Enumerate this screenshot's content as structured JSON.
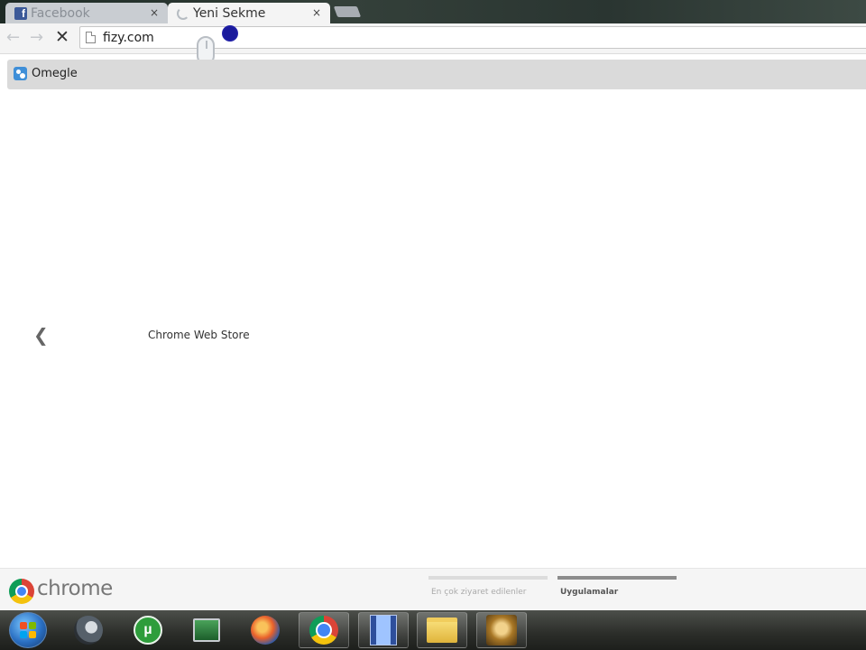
{
  "browser": {
    "tabs": [
      {
        "title": "Facebook",
        "icon": "facebook-icon",
        "state": "inactive"
      },
      {
        "title": "Yeni Sekme",
        "icon": "loading-spinner-icon",
        "state": "active"
      }
    ],
    "close_glyph": "×",
    "omnibox": {
      "url": "fizy.com"
    },
    "nav": {
      "back_glyph": "←",
      "forward_glyph": "→",
      "stop_glyph": "✕"
    },
    "bookmarks": [
      {
        "label": "Omegle",
        "icon": "omegle-icon"
      }
    ]
  },
  "new_tab_page": {
    "prev_glyph": "❮",
    "apps": [
      {
        "label": "Chrome Web Store"
      }
    ],
    "brand": "chrome",
    "pages": [
      {
        "label": "En çok ziyaret edilenler",
        "active": false
      },
      {
        "label": "Uygulamalar",
        "active": true
      }
    ]
  },
  "taskbar": {
    "items": [
      {
        "icon": "steam-icon",
        "open": false
      },
      {
        "icon": "utorrent-icon",
        "open": false
      },
      {
        "icon": "monitor-icon",
        "open": false
      },
      {
        "icon": "firefox-icon",
        "open": false
      },
      {
        "icon": "chrome-icon",
        "open": true
      },
      {
        "icon": "video-editor-icon",
        "open": true
      },
      {
        "icon": "folder-icon",
        "open": true
      },
      {
        "icon": "game-icon",
        "open": true
      }
    ],
    "utorrent_glyph": "µ"
  },
  "colors": {
    "facebook": "#3b5998",
    "omegle": "#3f8fd8",
    "bookmark_bar": "#dadada",
    "click_dot": "#1a1a9c"
  }
}
